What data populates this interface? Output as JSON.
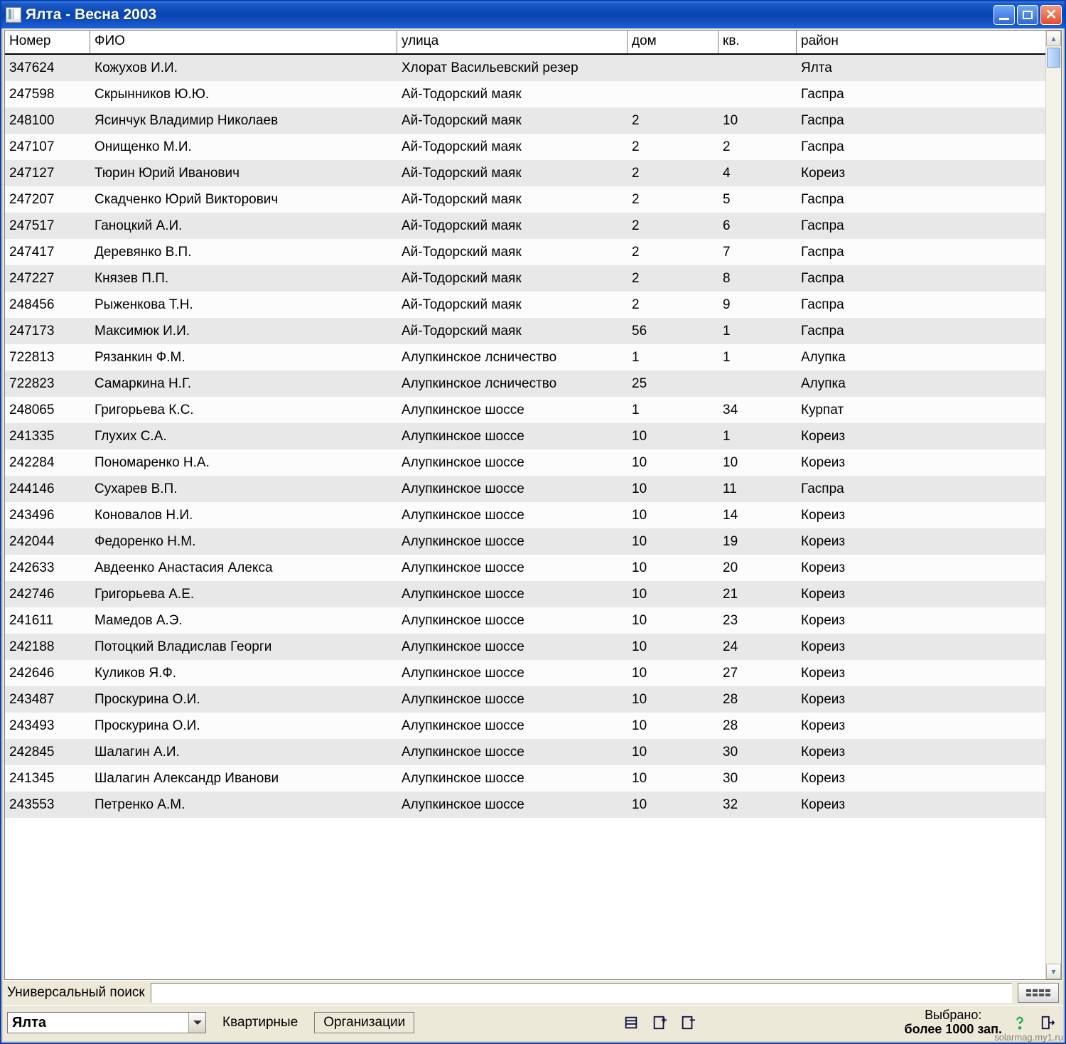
{
  "window": {
    "title": "Ялта  - Весна 2003"
  },
  "columns": {
    "num": "Номер",
    "fio": "ФИО",
    "street": "улица",
    "house": "дом",
    "apt": "кв.",
    "area": "район"
  },
  "rows": [
    {
      "num": "347624",
      "fio": "Кожухов И.И.",
      "street": " Хлорат Васильевский резер",
      "house": "",
      "apt": "",
      "area": "Ялта"
    },
    {
      "num": "247598",
      "fio": "Скрынников Ю.Ю.",
      "street": "Ай-Тодорский маяк",
      "house": "",
      "apt": "",
      "area": "Гаспра"
    },
    {
      "num": "248100",
      "fio": "Ясинчук Владимир Николаев",
      "street": "Ай-Тодорский маяк",
      "house": "2",
      "apt": "10",
      "area": "Гаспра"
    },
    {
      "num": "247107",
      "fio": "Онищенко М.И.",
      "street": "Ай-Тодорский маяк",
      "house": "2",
      "apt": "2",
      "area": "Гаспра"
    },
    {
      "num": "247127",
      "fio": "Тюрин Юрий Иванович",
      "street": "Ай-Тодорский маяк",
      "house": "2",
      "apt": "4",
      "area": "Кореиз"
    },
    {
      "num": "247207",
      "fio": "Скадченко Юрий Викторович",
      "street": "Ай-Тодорский маяк",
      "house": "2",
      "apt": "5",
      "area": "Гаспра"
    },
    {
      "num": "247517",
      "fio": "Ганоцкий А.И.",
      "street": "Ай-Тодорский маяк",
      "house": "2",
      "apt": "6",
      "area": "Гаспра"
    },
    {
      "num": "247417",
      "fio": "Деревянко В.П.",
      "street": "Ай-Тодорский маяк",
      "house": "2",
      "apt": "7",
      "area": "Гаспра"
    },
    {
      "num": "247227",
      "fio": "Князев П.П.",
      "street": "Ай-Тодорский маяк",
      "house": "2",
      "apt": "8",
      "area": "Гаспра"
    },
    {
      "num": "248456",
      "fio": "Рыженкова Т.Н.",
      "street": "Ай-Тодорский маяк",
      "house": "2",
      "apt": "9",
      "area": "Гаспра"
    },
    {
      "num": "247173",
      "fio": "Максимюк И.И.",
      "street": "Ай-Тодорский маяк",
      "house": "56",
      "apt": "1",
      "area": "Гаспра"
    },
    {
      "num": "722813",
      "fio": "Рязанкин Ф.М.",
      "street": "Алупкинское лсничество",
      "house": "1",
      "apt": "1",
      "area": "Алупка"
    },
    {
      "num": "722823",
      "fio": "Самаркина Н.Г.",
      "street": "Алупкинское лсничество",
      "house": "25",
      "apt": "",
      "area": "Алупка"
    },
    {
      "num": "248065",
      "fio": "Григорьева К.С.",
      "street": "Алупкинское шоссе",
      "house": "1",
      "apt": "34",
      "area": "Курпат"
    },
    {
      "num": "241335",
      "fio": "Глухих С.А.",
      "street": "Алупкинское шоссе",
      "house": "10",
      "apt": "1",
      "area": "Кореиз"
    },
    {
      "num": "242284",
      "fio": "Пономаренко Н.А.",
      "street": "Алупкинское шоссе",
      "house": "10",
      "apt": "10",
      "area": "Кореиз"
    },
    {
      "num": "244146",
      "fio": "Сухарев В.П.",
      "street": "Алупкинское шоссе",
      "house": "10",
      "apt": "11",
      "area": "Гаспра"
    },
    {
      "num": "243496",
      "fio": "Коновалов Н.И.",
      "street": "Алупкинское шоссе",
      "house": "10",
      "apt": "14",
      "area": "Кореиз"
    },
    {
      "num": "242044",
      "fio": "Федоренко Н.М.",
      "street": "Алупкинское шоссе",
      "house": "10",
      "apt": "19",
      "area": "Кореиз"
    },
    {
      "num": "242633",
      "fio": "Авдеенко Анастасия Алекса",
      "street": "Алупкинское шоссе",
      "house": "10",
      "apt": "20",
      "area": "Кореиз"
    },
    {
      "num": "242746",
      "fio": "Григорьева А.Е.",
      "street": "Алупкинское шоссе",
      "house": "10",
      "apt": "21",
      "area": "Кореиз"
    },
    {
      "num": "241611",
      "fio": "Мамедов А.Э.",
      "street": "Алупкинское шоссе",
      "house": "10",
      "apt": "23",
      "area": "Кореиз"
    },
    {
      "num": "242188",
      "fio": "Потоцкий Владислав Георги",
      "street": "Алупкинское шоссе",
      "house": "10",
      "apt": "24",
      "area": "Кореиз"
    },
    {
      "num": "242646",
      "fio": "Куликов Я.Ф.",
      "street": "Алупкинское шоссе",
      "house": "10",
      "apt": "27",
      "area": "Кореиз"
    },
    {
      "num": "243487",
      "fio": "Проскурина О.И.",
      "street": "Алупкинское шоссе",
      "house": "10",
      "apt": "28",
      "area": "Кореиз"
    },
    {
      "num": "243493",
      "fio": "Проскурина О.И.",
      "street": "Алупкинское шоссе",
      "house": "10",
      "apt": "28",
      "area": "Кореиз"
    },
    {
      "num": "242845",
      "fio": "Шалагин А.И.",
      "street": "Алупкинское шоссе",
      "house": "10",
      "apt": "30",
      "area": "Кореиз"
    },
    {
      "num": "241345",
      "fio": "Шалагин Александр Иванови",
      "street": "Алупкинское шоссе",
      "house": "10",
      "apt": "30",
      "area": "Кореиз"
    },
    {
      "num": "243553",
      "fio": "Петренко А.М.",
      "street": "Алупкинское шоссе",
      "house": "10",
      "apt": "32",
      "area": "Кореиз"
    }
  ],
  "search": {
    "label": "Универсальный поиск",
    "value": ""
  },
  "toolbar": {
    "combo_value": "Ялта",
    "btn_residential": "Квартирные",
    "btn_org": "Организации"
  },
  "status": {
    "selected_label": "Выбрано:",
    "count_label": "более 1000 зап."
  },
  "watermark": "solarmag.my1.ru"
}
